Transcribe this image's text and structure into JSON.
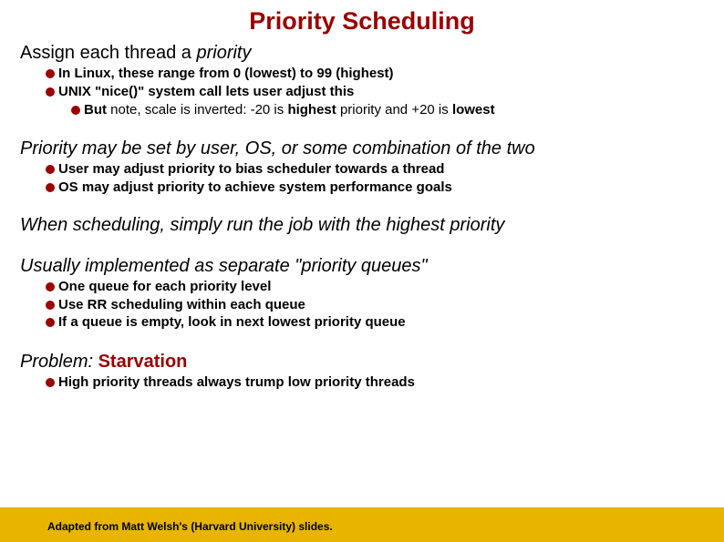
{
  "title": "Priority Scheduling",
  "sections": [
    {
      "heading_pre": "Assign each thread a ",
      "heading_italic": "priority",
      "heading_post": "",
      "bullets": [
        {
          "level": 1,
          "segments": [
            {
              "t": "In Linux, these range from 0 (lowest) to 99 (highest)",
              "b": true
            }
          ]
        },
        {
          "level": 1,
          "segments": [
            {
              "t": "UNIX \"nice()\" system call lets user adjust this",
              "b": true
            }
          ]
        },
        {
          "level": 2,
          "segments": [
            {
              "t": "But",
              "b": true
            },
            {
              "t": " note, scale is inverted: -20 is ",
              "b": false
            },
            {
              "t": "highest",
              "b": true
            },
            {
              "t": " priority and +20 is ",
              "b": false
            },
            {
              "t": "lowest",
              "b": true
            }
          ]
        }
      ]
    },
    {
      "heading_pre": "",
      "heading_italic": "Priority may be set by user, OS, or some combination of the two",
      "heading_post": "",
      "bullets": [
        {
          "level": 1,
          "segments": [
            {
              "t": "User",
              "b": true
            },
            {
              "t": " may adjust priority to bias scheduler towards a thread",
              "b": true
            }
          ]
        },
        {
          "level": 1,
          "segments": [
            {
              "t": "OS",
              "b": true
            },
            {
              "t": " may adjust priority to achieve system performance goals",
              "b": true
            }
          ]
        }
      ]
    },
    {
      "heading_pre": "",
      "heading_italic": "When scheduling, simply run the job with the highest priority",
      "heading_post": "",
      "bullets": []
    },
    {
      "heading_pre": "",
      "heading_italic": "Usually implemented as separate \"priority queues\"",
      "heading_post": "",
      "bullets": [
        {
          "level": 1,
          "segments": [
            {
              "t": "One queue for each priority level",
              "b": true
            }
          ]
        },
        {
          "level": 1,
          "segments": [
            {
              "t": "Use RR scheduling within each queue",
              "b": true
            }
          ]
        },
        {
          "level": 1,
          "segments": [
            {
              "t": "If a queue is empty, look in next lowest priority queue",
              "b": true
            }
          ]
        }
      ]
    },
    {
      "heading_pre": "",
      "heading_italic": "Problem: ",
      "heading_post": "",
      "heading_starvation": "Starvation",
      "bullets": [
        {
          "level": 1,
          "segments": [
            {
              "t": "High",
              "b": true
            },
            {
              "t": " priority threads always trump low priority threads",
              "b": true
            }
          ]
        }
      ]
    }
  ],
  "footer": "Adapted from Matt Welsh's (Harvard University) slides."
}
